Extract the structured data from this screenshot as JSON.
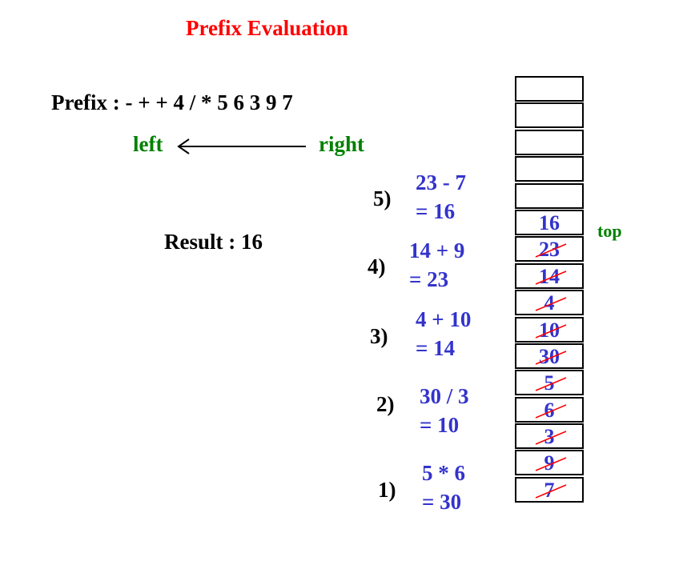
{
  "title": "Prefix Evaluation",
  "expression": "Prefix : - + + 4 / * 5 6 3 9 7",
  "direction": {
    "left": "left",
    "right": "right"
  },
  "result": "Result : 16",
  "top_label": "top",
  "colors": {
    "title": "#ff0000",
    "direction": "#008000",
    "steps": "#3333cc",
    "strike": "#ff0000"
  },
  "steps": [
    {
      "num": "5)",
      "line1": "23 - 7",
      "line2": "= 16"
    },
    {
      "num": "4)",
      "line1": "14 + 9",
      "line2": "= 23"
    },
    {
      "num": "3)",
      "line1": "4 + 10",
      "line2": "= 14"
    },
    {
      "num": "2)",
      "line1": "30 / 3",
      "line2": "= 10"
    },
    {
      "num": "1)",
      "line1": "5 * 6",
      "line2": "= 30"
    }
  ],
  "stack": [
    {
      "value": "",
      "struck": false
    },
    {
      "value": "",
      "struck": false
    },
    {
      "value": "",
      "struck": false
    },
    {
      "value": "",
      "struck": false
    },
    {
      "value": "",
      "struck": false
    },
    {
      "value": "16",
      "struck": false
    },
    {
      "value": "23",
      "struck": true
    },
    {
      "value": "14",
      "struck": true
    },
    {
      "value": "4",
      "struck": true
    },
    {
      "value": "10",
      "struck": true
    },
    {
      "value": "30",
      "struck": true
    },
    {
      "value": "5",
      "struck": true
    },
    {
      "value": "6",
      "struck": true
    },
    {
      "value": "3",
      "struck": true
    },
    {
      "value": "9",
      "struck": true
    },
    {
      "value": "7",
      "struck": true
    }
  ]
}
